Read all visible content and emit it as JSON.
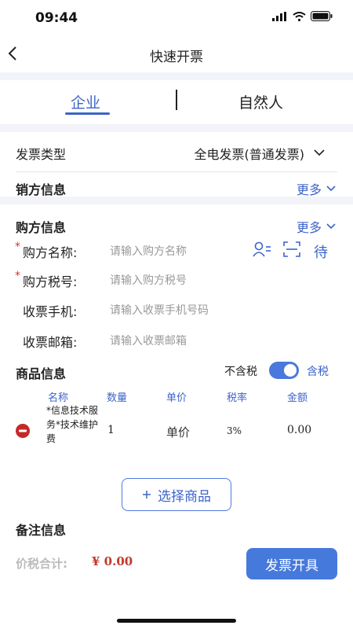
{
  "status": {
    "time": "09:44"
  },
  "nav": {
    "title": "快速开票"
  },
  "tabs": [
    {
      "label": "企业"
    },
    {
      "label": "自然人"
    }
  ],
  "invoice_type": {
    "label": "发票类型",
    "value": "全电发票(普通发票)"
  },
  "seller": {
    "title": "销方信息",
    "more": "更多"
  },
  "buyer": {
    "title": "购方信息",
    "more": "更多",
    "name": {
      "label": "购方名称:",
      "placeholder": "请输入购方名称"
    },
    "tax_id": {
      "label": "购方税号:",
      "placeholder": "请输入购方税号"
    },
    "phone": {
      "label": "收票手机:",
      "placeholder": "请输入收票手机号码"
    },
    "email": {
      "label": "收票邮箱:",
      "placeholder": "请输入收票邮箱"
    },
    "pending": "待"
  },
  "goods": {
    "title": "商品信息",
    "tax_excl": "不含税",
    "tax_incl": "含税",
    "tax_included": true,
    "columns": [
      "名称",
      "数量",
      "单价",
      "税率",
      "金额"
    ],
    "rows": [
      {
        "name": "*信息技术服务*技术维护费",
        "qty": "1",
        "price": "单价",
        "rate": "3%",
        "amount": "0.00"
      }
    ],
    "select_button": "选择商品"
  },
  "remarks": {
    "title": "备注信息"
  },
  "footer": {
    "total_label": "价税合计:",
    "total_value": "¥ 0.00",
    "submit": "发票开具"
  },
  "colors": {
    "accent": "#3c64c8",
    "primary_button": "#4679dc",
    "required": "#e0302a",
    "delete": "#c62828"
  },
  "icons": [
    "chevron-left-icon",
    "chevron-down-icon",
    "contact-icon",
    "scan-icon",
    "minus-circle-icon",
    "plus-icon"
  ]
}
